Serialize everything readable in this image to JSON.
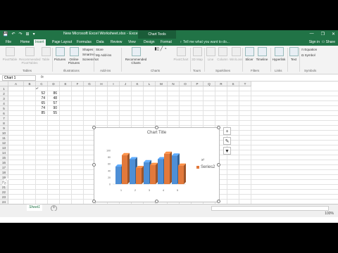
{
  "window": {
    "qat": [
      "💾",
      "↶",
      "↷",
      "⊞",
      "▾"
    ],
    "doc_title": "New Microsoft Excel Worksheet.xlsx - Excel",
    "context_label": "Chart Tools",
    "controls": [
      "—",
      "❐",
      "✕"
    ]
  },
  "tabs": [
    "File",
    "Home",
    "Insert",
    "Page Layout",
    "Formulas",
    "Data",
    "Review",
    "View",
    "Design",
    "Format"
  ],
  "tell_me": "♀ Tell me what you want to do...",
  "signin": "Sign in",
  "share": "⚇ Share",
  "ribbon": {
    "buttons": [
      "PivotTable",
      "Recommended PivotTables",
      "Table",
      "Pictures",
      "Online Pictures",
      "Recommended Charts",
      "PivotChart",
      "3D Map",
      "Line",
      "Column",
      "Win/Loss",
      "Slicer",
      "Timeline",
      "Hyperlink",
      "Text",
      "Equation",
      "Symbol"
    ],
    "small": [
      "Shapes",
      "SmartArt",
      "Screenshot",
      "Store",
      "My Add-ins"
    ],
    "groups": [
      "Tables",
      "Illustrations",
      "Add-ins",
      "Charts",
      "Tours",
      "Sparklines",
      "Filters",
      "Links",
      "Symbols"
    ]
  },
  "name_box": "Chart 1",
  "fx": "fx",
  "columns": [
    "A",
    "B",
    "C",
    "D",
    "E",
    "F",
    "G",
    "H",
    "I",
    "J",
    "K",
    "L",
    "M",
    "N",
    "O",
    "P",
    "Q",
    "R",
    "S",
    "T"
  ],
  "rows": [
    "1",
    "2",
    "3",
    "4",
    "5",
    "6",
    "7",
    "8",
    "9",
    "10",
    "11",
    "12",
    "13",
    "14",
    "15",
    "16",
    "17",
    "18",
    "19",
    "20",
    "21",
    "22",
    "23",
    "24"
  ],
  "cell_c1": "x²",
  "table": {
    "col1": [
      "52",
      "74",
      "65",
      "74",
      "85"
    ],
    "col2": [
      "86",
      "48",
      "57",
      "90",
      "55"
    ]
  },
  "chart_data": {
    "type": "bar",
    "title": "Chart Title",
    "categories": [
      "1",
      "2",
      "3",
      "4",
      "5"
    ],
    "ylim": [
      0,
      100
    ],
    "y_ticks": [
      "100",
      "80",
      "60",
      "40",
      "20",
      "0"
    ],
    "series": [
      {
        "name": "",
        "values": [
          52,
          74,
          65,
          74,
          85
        ],
        "color": "#4e8fd6"
      },
      {
        "name": "Series2",
        "values": [
          86,
          48,
          57,
          90,
          55
        ],
        "color": "#e2793b"
      }
    ],
    "legend": "right",
    "overlay_label": "x²"
  },
  "side_buttons": [
    "+",
    "✎",
    "▼"
  ],
  "sheet_tab": "Sheet1",
  "add_sheet": "+",
  "zoom": "100%"
}
